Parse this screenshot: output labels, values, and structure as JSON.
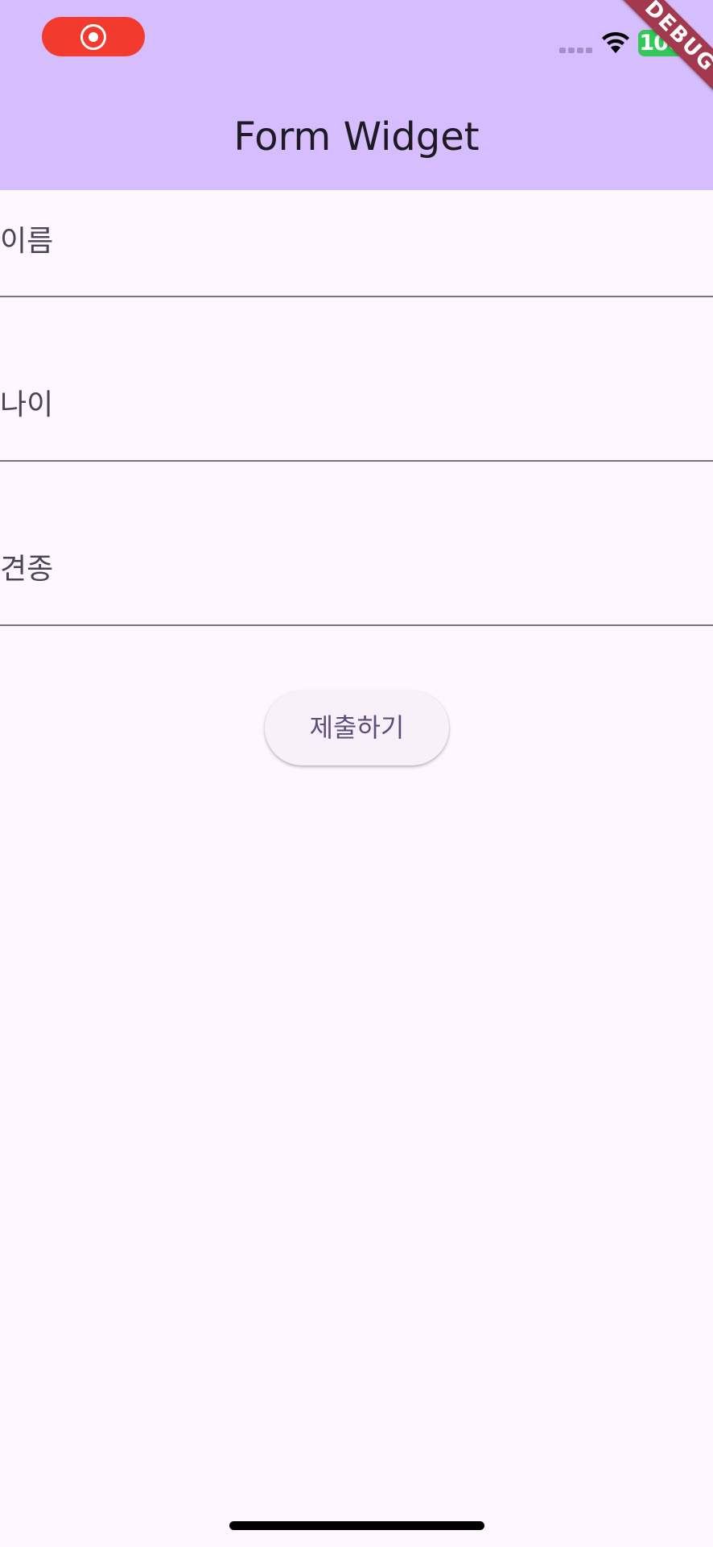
{
  "app_bar": {
    "title": "Form Widget",
    "background": "#d6bdfd"
  },
  "status_bar": {
    "recording_indicator": "record-icon",
    "battery_level": "100",
    "battery_color": "#34c759",
    "wifi_icon": "wifi-icon",
    "signal_icon": "cellular-signal-icon"
  },
  "debug_banner": {
    "label": "DEBUG",
    "color": "#a3394e"
  },
  "form": {
    "fields": [
      {
        "label": "이름",
        "value": ""
      },
      {
        "label": "나이",
        "value": ""
      },
      {
        "label": "견종",
        "value": ""
      }
    ],
    "submit_label": "제출하기"
  },
  "colors": {
    "page_background": "#fef7ff",
    "underline": "#79747e",
    "label_text": "#4a4458"
  }
}
